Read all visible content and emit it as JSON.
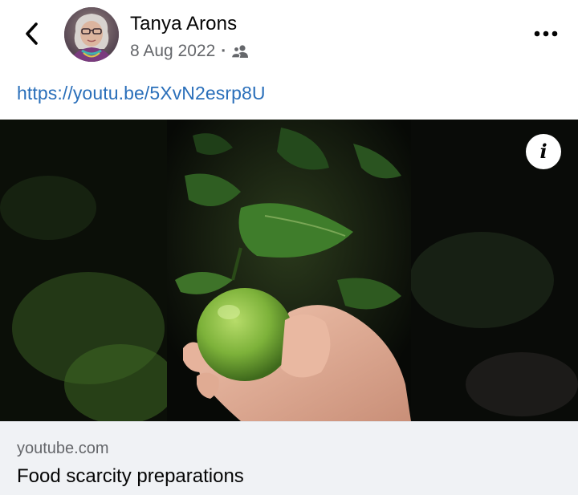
{
  "post": {
    "author": "Tanya Arons",
    "date": "8 Aug 2022",
    "separator": "·",
    "audience_icon": "friends-icon",
    "link_text": "https://youtu.be/5XvN2esrp8U"
  },
  "icons": {
    "back": "back-chevron-icon",
    "more": "more-options-icon",
    "info": "info-icon"
  },
  "info_glyph": "i",
  "link_preview": {
    "domain": "youtube.com",
    "title": "Food scarcity preparations"
  },
  "colors": {
    "link": "#2a6fba",
    "secondary_text": "#65676b",
    "card_bg": "#f0f2f5"
  }
}
